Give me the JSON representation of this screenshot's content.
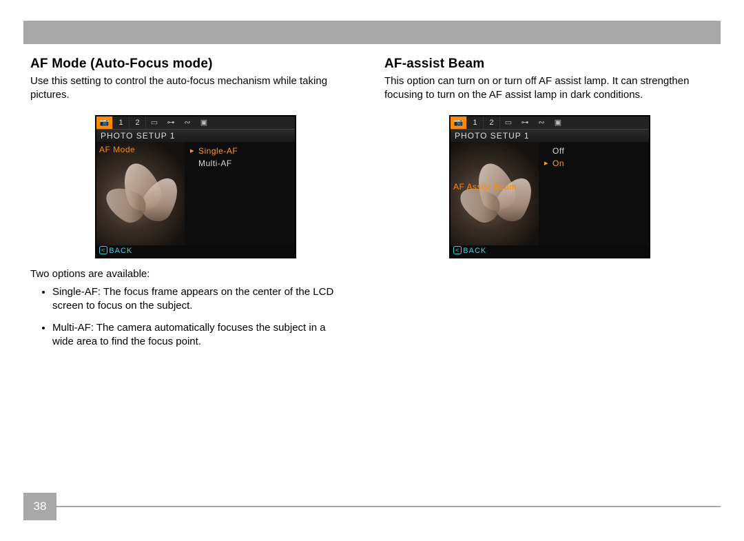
{
  "page_number": "38",
  "left": {
    "heading": "AF Mode (Auto-Focus mode)",
    "desc": "Use this setting to control the auto-focus mechanism while taking pictures.",
    "options_intro": "Two options are available:",
    "bullets": [
      "Single-AF: The focus frame appears on the center of the LCD screen to focus on the subject.",
      "Multi-AF: The camera automatically focuses the subject in a wide area to find the focus point."
    ],
    "lcd": {
      "tabs": [
        "📷",
        "1",
        "2"
      ],
      "title": "PHOTO SETUP 1",
      "item": "AF Mode",
      "options": [
        {
          "label": "Single-AF",
          "selected": true
        },
        {
          "label": "Multi-AF",
          "selected": false
        }
      ],
      "back": "BACK"
    }
  },
  "right": {
    "heading": "AF-assist Beam",
    "desc": "This option can turn on or turn off AF assist lamp. It can strengthen focusing to turn on the AF assist lamp in dark conditions.",
    "lcd": {
      "tabs": [
        "📷",
        "1",
        "2"
      ],
      "title": "PHOTO SETUP 1",
      "item": "AF Assist Beam",
      "options": [
        {
          "label": "Off",
          "selected": false
        },
        {
          "label": "On",
          "selected": true
        }
      ],
      "back": "BACK"
    }
  }
}
